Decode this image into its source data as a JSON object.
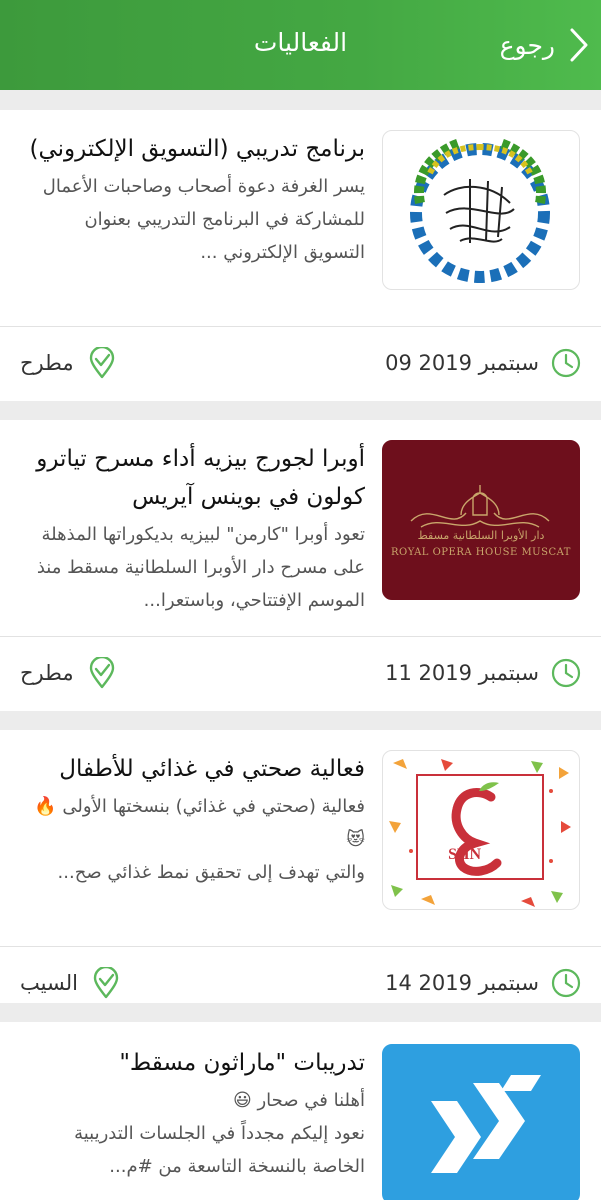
{
  "header": {
    "title": "الفعاليات",
    "back_label": "رجوع"
  },
  "events": [
    {
      "title": "برنامج تدريبي (التسويق الإلكتروني)",
      "description": "يسر الغرفة دعوة أصحاب وصاحبات الأعمال للمشاركة في البرنامج التدريبي بعنوان التسويق الإلكتروني ...",
      "date": "09 سبتمبر 2019",
      "location": "مطرح",
      "image": "chamber-of-commerce-logo"
    },
    {
      "title": "أوبرا لجورج بيزيه أداء مسرح تياترو كولون في بوينس آيريس",
      "description": "تعود أوبرا \"كارمن\" لبيزيه بديكوراتها المذهلة على مسرح دار الأوبرا السلطانية مسقط منذ الموسم الإفتتاحي، وباستعرا...",
      "date": "11 سبتمبر 2019",
      "location": "مطرح",
      "image": "royal-opera-house-logo",
      "image_text_ar": "دار الأوبرا السلطانية مسقط",
      "image_text_en": "ROYAL OPERA HOUSE MUSCAT"
    },
    {
      "title": "فعالية صحتي في غذائي للأطفال",
      "description_line1": "فعالية (صحتي في غذائي) بنسختها الأولى 🔥😻",
      "description_line2": "والتي تهدف إلى تحقيق نمط غذائي صح...",
      "date": "14 سبتمبر 2019",
      "location": "السيب",
      "image": "shn-logo",
      "image_text": "SHN"
    },
    {
      "title": "تدريبات \"ماراثون مسقط\"",
      "description_line1": "أهلنا في صحار 😃",
      "description_line2": "نعود إليكم مجدداً في الجلسات التدريبية الخاصة بالنسخة التاسعة من #م...",
      "image": "marathon-logo"
    }
  ],
  "colors": {
    "header_green": "#44a843",
    "accent_green": "#5cb85c",
    "opera_maroon": "#6e0f1c",
    "marathon_blue": "#2e9fe0"
  }
}
